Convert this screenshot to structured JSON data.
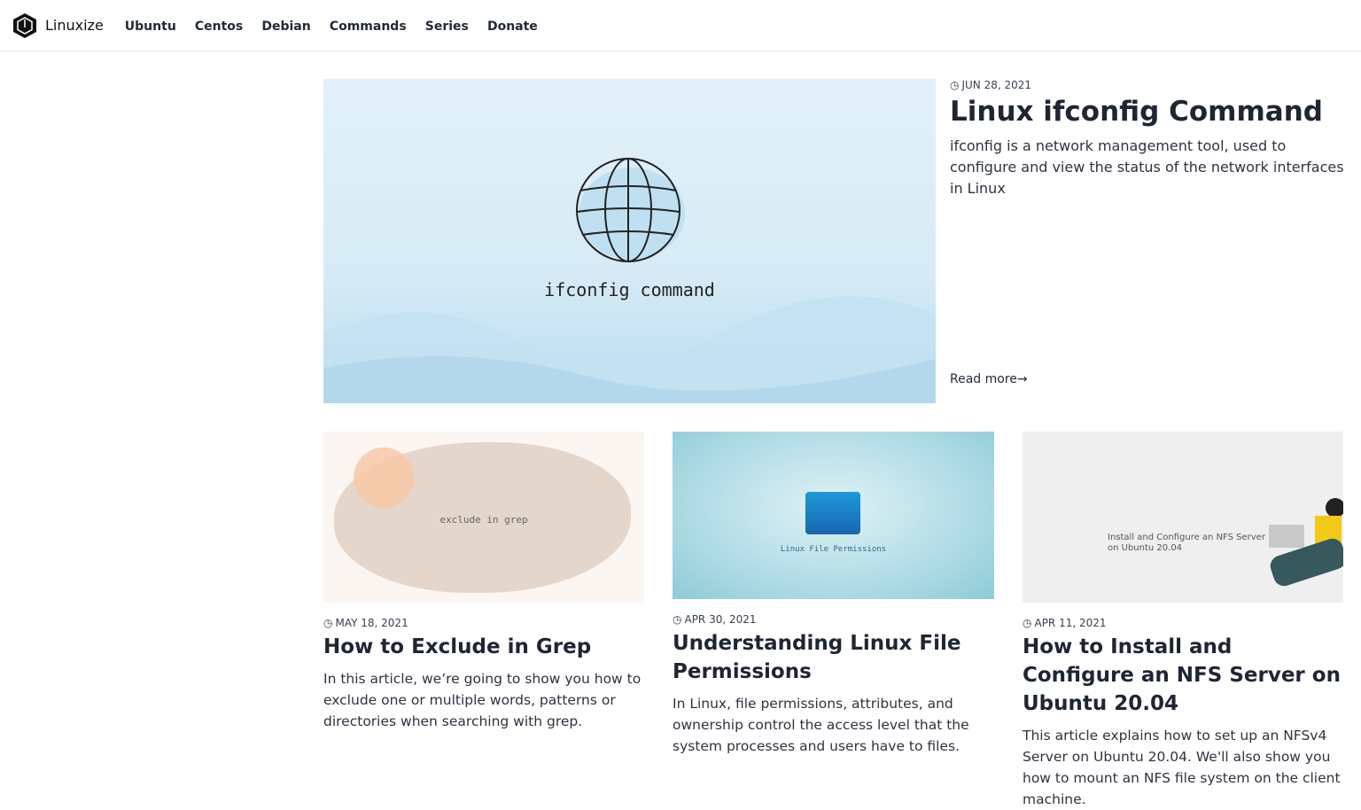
{
  "header": {
    "brand": "Linuxize",
    "nav": [
      "Ubuntu",
      "Centos",
      "Debian",
      "Commands",
      "Series",
      "Donate"
    ]
  },
  "featured": {
    "date": "JUN 28, 2021",
    "title": "Linux ifconfig Command",
    "excerpt": "ifconfig is a network management tool, used to configure and view the status of the network interfaces in Linux",
    "read_more": "Read more",
    "image_caption": "ifconfig command"
  },
  "posts": [
    {
      "date": "MAY 18, 2021",
      "title": "How to Exclude in Grep",
      "excerpt": "In this article, we’re going to show you how to exclude one or multiple words, patterns or directories when searching with grep.",
      "image_caption": "exclude in grep"
    },
    {
      "date": "APR 30, 2021",
      "title": "Understanding Linux File Permissions",
      "excerpt": "In Linux, file permissions, attributes, and ownership control the access level that the system processes and users have to files.",
      "image_caption": "Linux File Permissions"
    },
    {
      "date": "APR 11, 2021",
      "title": "How to Install and Configure an NFS Server on Ubuntu 20.04",
      "excerpt": "This article explains how to set up an NFSv4 Server on Ubuntu 20.04. We'll also show you how to mount an NFS file system on the client machine.",
      "image_caption": "Install and Configure an NFS Server on Ubuntu 20.04"
    }
  ]
}
